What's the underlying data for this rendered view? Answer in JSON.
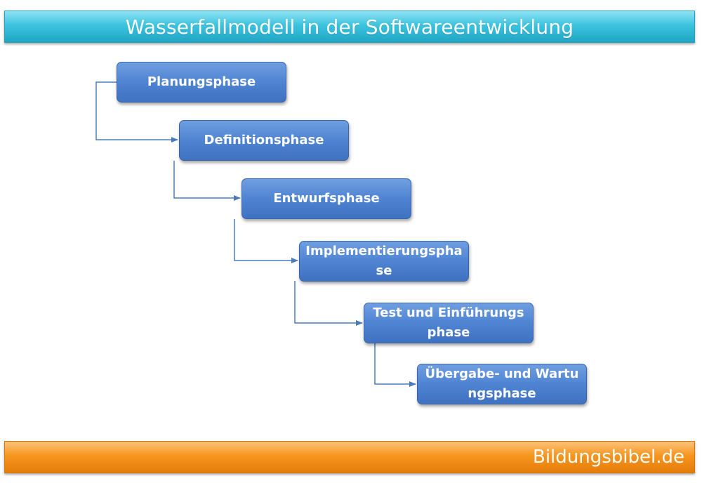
{
  "header": {
    "title": "Wasserfallmodell in der Softwareentwicklung"
  },
  "phases": [
    {
      "label": "Planungsphase"
    },
    {
      "label": "Definitionsphase"
    },
    {
      "label": "Entwurfsphase"
    },
    {
      "label": "Implementierungsphase"
    },
    {
      "label": "Test und Einführungsphase"
    },
    {
      "label": "Übergabe- und Wartungsphase"
    }
  ],
  "footer": {
    "brand": "Bildungsbibel.de"
  },
  "colors": {
    "title_bar": "#3cc3df",
    "footer_bar": "#f6961f",
    "phase_box": "#4f84d2",
    "connector": "#4a7bbd"
  }
}
